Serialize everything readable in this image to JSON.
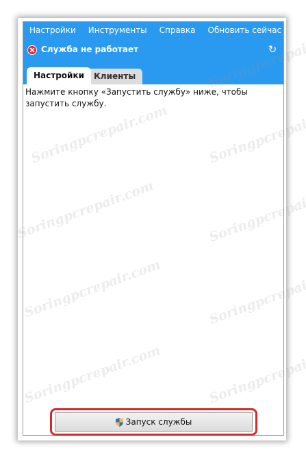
{
  "menu": {
    "items": [
      {
        "label": "Настройки"
      },
      {
        "label": "Инструменты"
      },
      {
        "label": "Справка"
      },
      {
        "label": "Обновить сейчас"
      }
    ]
  },
  "status": {
    "text": "Служба не работает",
    "icon": "error-icon",
    "refresh_icon": "refresh-icon"
  },
  "tabs": [
    {
      "label": "Настройки",
      "active": true
    },
    {
      "label": "Клиенты",
      "active": false
    }
  ],
  "content": {
    "message": "Нажмите кнопку «Запустить службу» ниже, чтобы запустить службу."
  },
  "start_button": {
    "label": "Запуск службы",
    "icon": "uac-shield-icon"
  },
  "watermark": "Soringpcrepair.com",
  "colors": {
    "accent": "#2a9af0",
    "error": "#e0242b",
    "highlight": "#d42a2a"
  }
}
